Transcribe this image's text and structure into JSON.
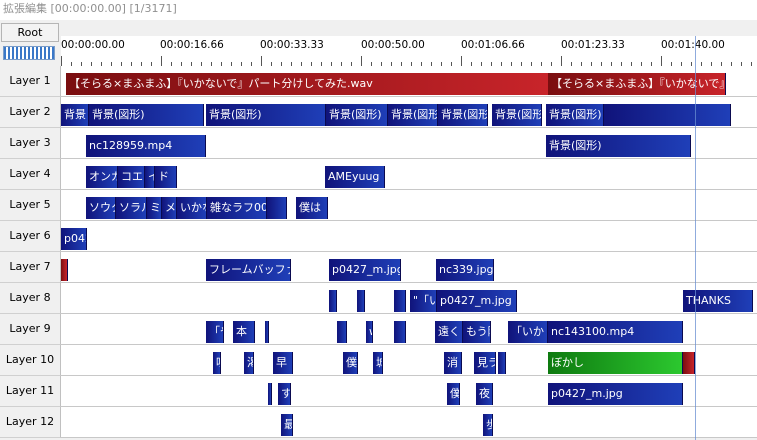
{
  "window": {
    "title": "拡張編集 [00:00:00.00] [1/3171]"
  },
  "header": {
    "root_label": "Root"
  },
  "ruler": {
    "labels": [
      "00:00:00.00",
      "00:00:16.66",
      "00:00:33.33",
      "00:00:50.00",
      "00:01:06.66",
      "00:01:23.33",
      "00:01:40.00"
    ]
  },
  "layers": [
    "Layer 1",
    "Layer 2",
    "Layer 3",
    "Layer 4",
    "Layer 5",
    "Layer 6",
    "Layer 7",
    "Layer 8",
    "Layer 9",
    "Layer 10",
    "Layer 11",
    "Layer 12"
  ],
  "colors": {
    "video": "#1f3fb8",
    "audio": "#c8242a",
    "filter": "#2cc82f"
  },
  "clips": [
    [
      {
        "label": "【そらる×まふまふ】『いかないで』パート分けしてみた.wav",
        "type": "audio"
      },
      {
        "label": "【そらる×まふまふ】『いかないで』パー",
        "type": "audio"
      }
    ],
    [
      {
        "label": "背景",
        "type": "video"
      },
      {
        "label": "背景(図形)",
        "type": "video"
      },
      {
        "label": "背景(図形)",
        "type": "video"
      },
      {
        "label": "背景(図形)",
        "type": "video"
      },
      {
        "label": "背景(図形",
        "type": "video"
      },
      {
        "label": "背景(図形",
        "type": "video"
      },
      {
        "label": "背景(図形",
        "type": "video"
      },
      {
        "label": "背景(図形)",
        "type": "video"
      },
      {
        "label": "",
        "type": "video"
      }
    ],
    [
      {
        "label": "nc128959.mp4",
        "type": "video"
      },
      {
        "label": "背景(図形)",
        "type": "video"
      }
    ],
    [
      {
        "label": "オンガ",
        "type": "video"
      },
      {
        "label": "コエ",
        "type": "video"
      },
      {
        "label": "イ",
        "type": "video"
      },
      {
        "label": "ド",
        "type": "video"
      },
      {
        "label": "AMEyuug",
        "type": "video"
      }
    ],
    [
      {
        "label": "ソウタ",
        "type": "video"
      },
      {
        "label": "ソラル",
        "type": "video"
      },
      {
        "label": "ミラ",
        "type": "video"
      },
      {
        "label": "メ",
        "type": "video"
      },
      {
        "label": "いかな",
        "type": "video"
      },
      {
        "label": "雑なラフ002",
        "type": "video"
      },
      {
        "label": "",
        "type": "video"
      },
      {
        "label": "僕は",
        "type": "video"
      }
    ],
    [
      {
        "label": "p042",
        "type": "video"
      }
    ],
    [
      {
        "label": "",
        "type": "audio"
      },
      {
        "label": "フレームバッファ[標",
        "type": "video"
      },
      {
        "label": "p0427_m.jpg",
        "type": "video"
      },
      {
        "label": "nc339.jpg",
        "type": "video"
      }
    ],
    [
      {
        "label": "",
        "type": "video"
      },
      {
        "label": "",
        "type": "video"
      },
      {
        "label": "",
        "type": "video"
      },
      {
        "label": "\"「い",
        "type": "video"
      },
      {
        "label": "p0427_m.jpg",
        "type": "video"
      },
      {
        "label": "THANKS",
        "type": "video"
      }
    ],
    [
      {
        "label": "「や",
        "type": "video"
      },
      {
        "label": "本",
        "type": "video"
      },
      {
        "label": "",
        "type": "video"
      },
      {
        "label": "",
        "type": "video"
      },
      {
        "label": "w",
        "type": "video"
      },
      {
        "label": "",
        "type": "video"
      },
      {
        "label": "遠く",
        "type": "video"
      },
      {
        "label": "もう随",
        "type": "video"
      },
      {
        "label": "「いか",
        "type": "video"
      },
      {
        "label": "nc143100.mp4",
        "type": "video"
      }
    ],
    [
      {
        "label": "吐",
        "type": "video"
      },
      {
        "label": "渇",
        "type": "video"
      },
      {
        "label": "早",
        "type": "video"
      },
      {
        "label": "僕",
        "type": "video"
      },
      {
        "label": "城",
        "type": "video"
      },
      {
        "label": "消",
        "type": "video"
      },
      {
        "label": "見ラ",
        "type": "video"
      },
      {
        "label": "",
        "type": "video"
      },
      {
        "label": "ぼかし",
        "type": "filter"
      },
      {
        "label": "",
        "type": "audio"
      }
    ],
    [
      {
        "label": "",
        "type": "video"
      },
      {
        "label": "す",
        "type": "video"
      },
      {
        "label": "僕",
        "type": "video"
      },
      {
        "label": "夜",
        "type": "video"
      },
      {
        "label": "p0427_m.jpg",
        "type": "video"
      }
    ],
    [
      {
        "label": "最",
        "type": "video"
      },
      {
        "label": "歩",
        "type": "video"
      }
    ]
  ]
}
